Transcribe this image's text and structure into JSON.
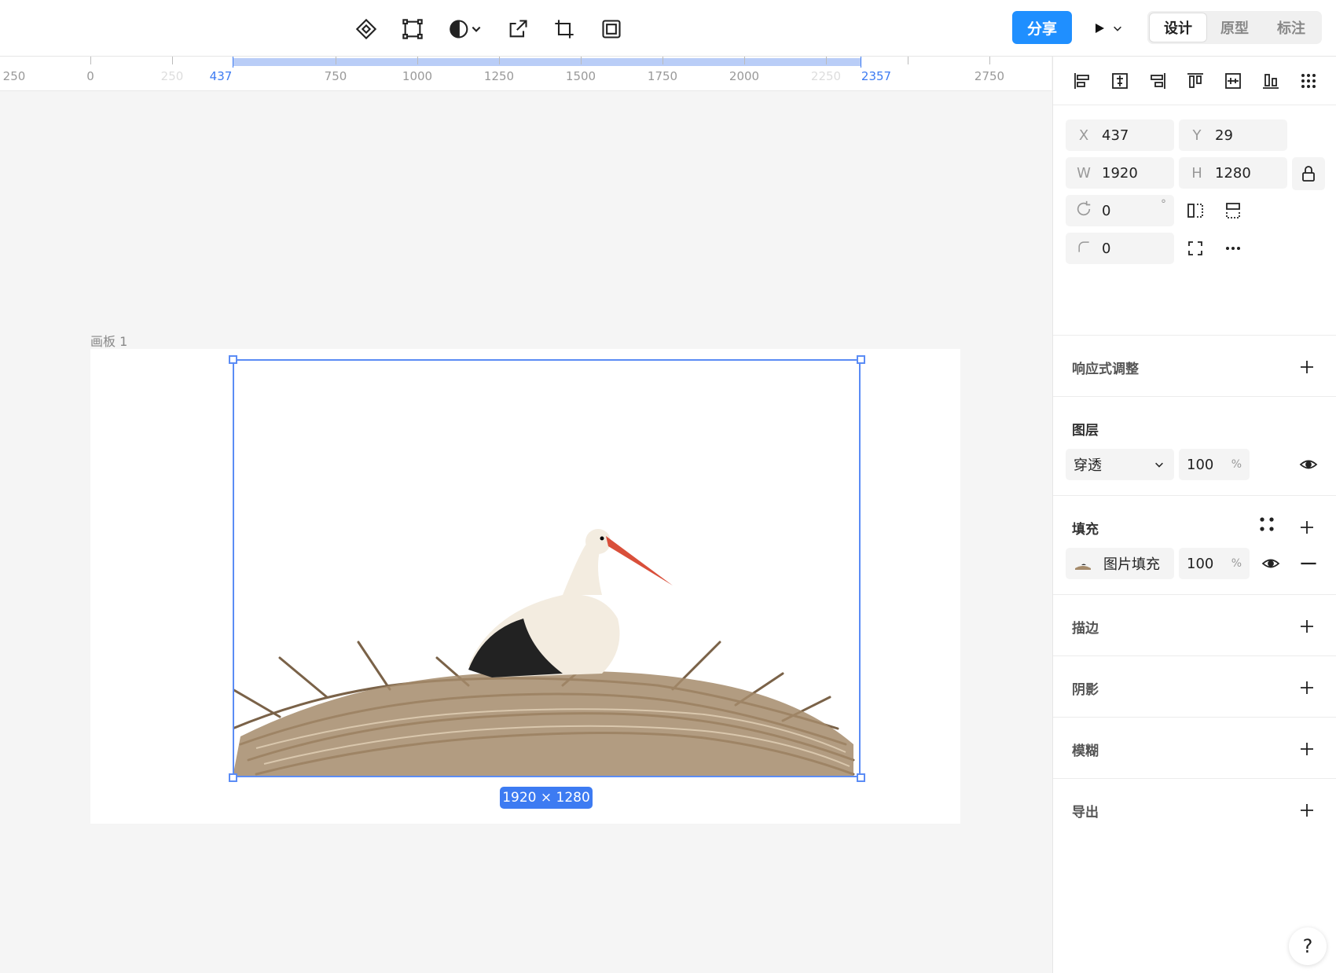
{
  "toolbar": {
    "tools": [
      {
        "name": "component-icon"
      },
      {
        "name": "transform-frame-icon"
      },
      {
        "name": "mask-contrast-icon"
      },
      {
        "name": "export-external-icon"
      },
      {
        "name": "crop-icon"
      },
      {
        "name": "inner-frame-icon"
      }
    ],
    "share_label": "分享",
    "mode_tabs": [
      {
        "label": "设计",
        "active": true
      },
      {
        "label": "原型",
        "active": false
      },
      {
        "label": "标注",
        "active": false
      }
    ]
  },
  "ruler": {
    "labels": [
      {
        "text": "250",
        "style": "normal"
      },
      {
        "text": "0",
        "style": "normal"
      },
      {
        "text": "250",
        "style": "faint"
      },
      {
        "text": "437",
        "style": "sel"
      },
      {
        "text": "750",
        "style": "normal"
      },
      {
        "text": "1000",
        "style": "normal"
      },
      {
        "text": "1250",
        "style": "normal"
      },
      {
        "text": "1500",
        "style": "normal"
      },
      {
        "text": "1750",
        "style": "normal"
      },
      {
        "text": "2000",
        "style": "normal"
      },
      {
        "text": "2250",
        "style": "faint"
      },
      {
        "text": "2357",
        "style": "sel"
      },
      {
        "text": "2750",
        "style": "normal"
      }
    ]
  },
  "canvas": {
    "board_label": "画板 1",
    "size_badge": "1920 × 1280"
  },
  "panel": {
    "x": {
      "label": "X",
      "value": "437"
    },
    "y": {
      "label": "Y",
      "value": "29"
    },
    "w": {
      "label": "W",
      "value": "1920"
    },
    "h": {
      "label": "H",
      "value": "1280"
    },
    "rotation": {
      "value": "0",
      "unit": "°"
    },
    "radius": {
      "value": "0"
    },
    "responsive": {
      "title": "响应式调整"
    },
    "layer": {
      "title": "图层",
      "blend": "穿透",
      "opacity": "100",
      "unit": "%"
    },
    "fill": {
      "title": "填充",
      "type": "图片填充",
      "opacity": "100",
      "unit": "%"
    },
    "stroke": {
      "title": "描边"
    },
    "shadow": {
      "title": "阴影"
    },
    "blur": {
      "title": "模糊"
    },
    "export": {
      "title": "导出"
    },
    "help": "?"
  },
  "colors": {
    "accent": "#1f8fff",
    "selection": "#5b8cf5"
  }
}
